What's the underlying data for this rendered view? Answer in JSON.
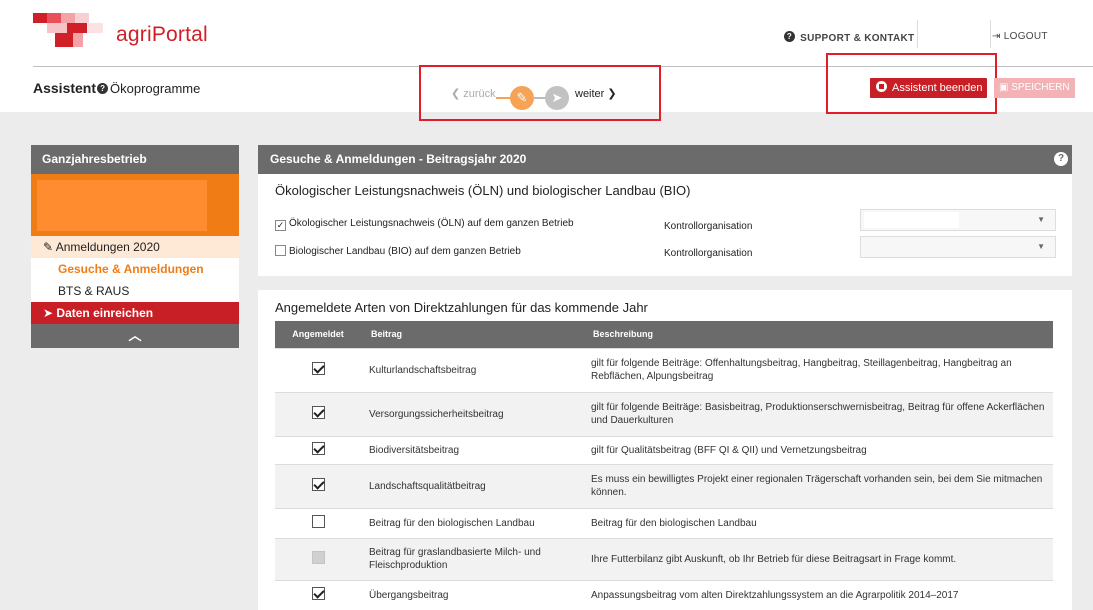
{
  "header": {
    "brand_prefix": "agri",
    "brand_suffix": "Portal",
    "support_label": "SUPPORT & KONTAKT",
    "logout_label": "LOGOUT",
    "assistant_label": "Assistent",
    "assistant_sub": "Ökoprogramme"
  },
  "wizard": {
    "back_label": "zurück",
    "next_label": "weiter"
  },
  "actions": {
    "end_label": "Assistent beenden",
    "save_label": "SPEICHERN"
  },
  "sidebar": {
    "title": "Ganzjahresbetrieb",
    "items": [
      {
        "label": "Anmeldungen 2020"
      },
      {
        "label": "Gesuche & Anmeldungen"
      },
      {
        "label": "BTS & RAUS"
      },
      {
        "label": "Daten einreichen"
      }
    ]
  },
  "panel1": {
    "header": "Gesuche & Anmeldungen - Beitragsjahr 2020",
    "title": "Ökologischer Leistungsnachweis (ÖLN) und biologischer Landbau (BIO)",
    "rows": [
      {
        "label": "Ökologischer Leistungsnachweis (ÖLN) auf dem ganzen Betrieb",
        "control": "Kontrollorganisation",
        "checked": true
      },
      {
        "label": "Biologischer Landbau (BIO) auf dem ganzen Betrieb",
        "control": "Kontrollorganisation",
        "checked": false
      }
    ]
  },
  "panel2": {
    "title": "Angemeldete Arten von Direktzahlungen für das kommende Jahr",
    "columns": [
      "Angemeldet",
      "Beitrag",
      "Beschreibung"
    ],
    "rows": [
      {
        "state": "checked",
        "beitrag": "Kulturlandschaftsbeitrag",
        "beschreibung": "gilt für folgende Beiträge: Offenhaltungsbeitrag, Hangbeitrag, Steillagenbeitrag, Hangbeitrag an Rebflächen, Alpungsbeitrag"
      },
      {
        "state": "checked",
        "beitrag": "Versorgungssicherheitsbeitrag",
        "beschreibung": "gilt für folgende Beiträge: Basisbeitrag, Produktionserschwernisbeitrag, Beitrag für offene Ackerflächen und Dauerkulturen"
      },
      {
        "state": "checked",
        "beitrag": "Biodiversitätsbeitrag",
        "beschreibung": "gilt für Qualitätsbeitrag (BFF QI & QII) und Vernetzungsbeitrag"
      },
      {
        "state": "checked",
        "beitrag": "Landschaftsqualitätbeitrag",
        "beschreibung": "Es muss ein bewilligtes Projekt einer regionalen Trägerschaft vorhanden sein, bei dem Sie mitmachen können."
      },
      {
        "state": "unchecked",
        "beitrag": "Beitrag für den biologischen Landbau",
        "beschreibung": "Beitrag für den biologischen Landbau"
      },
      {
        "state": "disabled",
        "beitrag": "Beitrag für graslandbasierte Milch- und Fleischproduktion",
        "beschreibung": "Ihre Futterbilanz gibt Auskunft, ob Ihr Betrieb für diese Beitragsart in Frage kommt."
      },
      {
        "state": "checked",
        "beitrag": "Übergangsbeitrag",
        "beschreibung": "Anpassungsbeitrag vom alten Direktzahlungssystem an die Agrarpolitik 2014–2017"
      }
    ]
  },
  "colors": {
    "brand_red": "#d01f26",
    "orange": "#f07c16",
    "header_gray": "#6b6b6b",
    "highlight_red": "#e11d2a"
  },
  "icons": [
    "logo-icon",
    "question-icon",
    "sign-out-icon",
    "chevron-left-icon",
    "pencil-icon",
    "paper-plane-icon",
    "chevron-right-icon",
    "stop-icon",
    "save-icon",
    "help-icon",
    "chevron-up-icon",
    "caret-down-icon"
  ]
}
